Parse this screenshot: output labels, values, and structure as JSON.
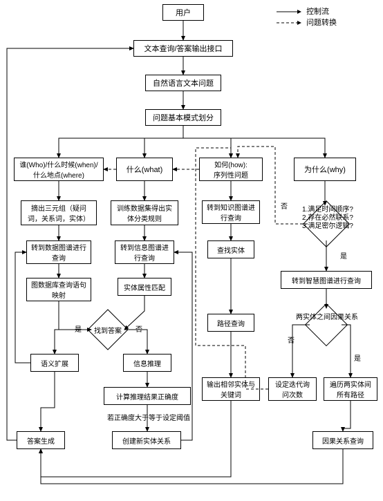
{
  "legend": {
    "control_flow": "控制流",
    "question_transform": "问题转换"
  },
  "nodes": {
    "user": "用户",
    "io": "文本查询/答案输出接口",
    "nlq": "自然语言文本问题",
    "classify": "问题基本模式划分",
    "who": "谁(Who)/什么时候(when)/什么地点(where)",
    "what": "什么(what)",
    "how": "如何(how):\n序列性问题",
    "why": "为什么(why)",
    "triple": "摘出三元组（疑问词，关系词，实体）",
    "train": "训练数据集得出实体分类规则",
    "to_kg": "转到知识图谱进行查询",
    "to_data": "转到数据图谱进行查询",
    "to_info": "转到信息图谱进行查询",
    "find_entity": "查找实体",
    "map_query": "图数据库查询语句映射",
    "attr_match": "实体属性匹配",
    "path_query": "路径查询",
    "found": "找到答案",
    "sem_expand": "语义扩展",
    "info_infer": "信息推理",
    "calc_acc": "计算推理结果正确度",
    "acc_note": "若正确度大于等于设定阈值",
    "new_rel": "创建新实体关系",
    "output_adj": "输出相邻实体与关键词",
    "answer": "答案生成",
    "why_cond": "1.满足时间顺序?\n2.存在必然联系?\n3.满足密尔逻辑?",
    "to_wisdom": "转到智慧图谱进行查询",
    "causal": "两实体之间因果关系",
    "set_iter": "设定迭代询问次数",
    "traverse": "遍历两实体间所有路径",
    "causal_query": "因果关系查询"
  },
  "labels": {
    "yes": "是",
    "no": "否"
  }
}
